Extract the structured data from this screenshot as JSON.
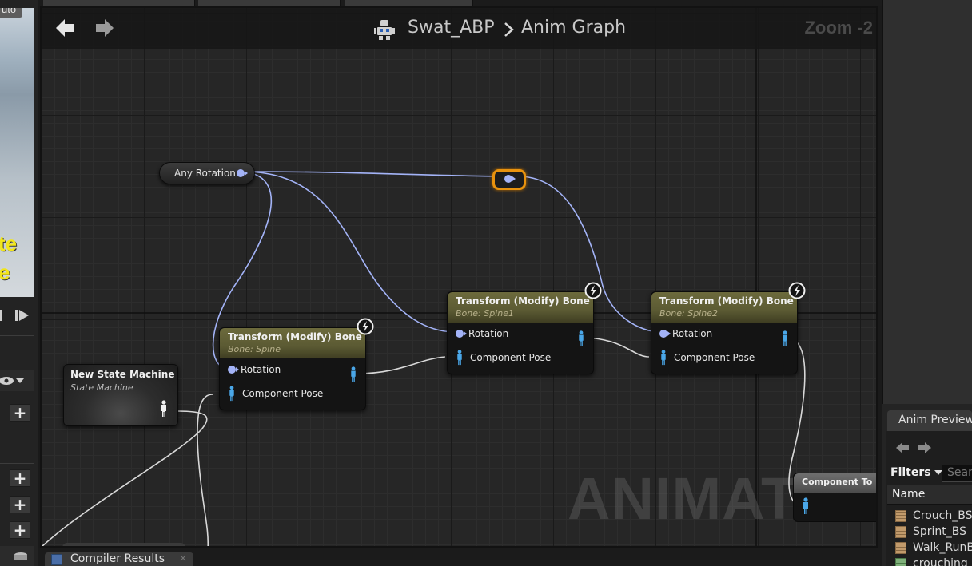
{
  "left": {
    "thumb_badge": "uto",
    "thumb_text_1": "te",
    "thumb_text_2": "e"
  },
  "graph": {
    "breadcrumb_asset": "Swat_ABP",
    "breadcrumb_graph": "Anim Graph",
    "zoom": "Zoom -2",
    "watermark": "ANIMATION"
  },
  "nodes": {
    "any_rotation": {
      "label": "Any Rotation"
    },
    "state_machine": {
      "title": "New State Machine",
      "subtitle": "State Machine"
    },
    "transform_spine": {
      "title": "Transform (Modify) Bone",
      "subtitle": "Bone: Spine",
      "pin_rotation": "Rotation",
      "pin_pose": "Component Pose"
    },
    "transform_spine1": {
      "title": "Transform (Modify) Bone",
      "subtitle": "Bone: Spine1",
      "pin_rotation": "Rotation",
      "pin_pose": "Component Pose"
    },
    "transform_spine2": {
      "title": "Transform (Modify) Bone",
      "subtitle": "Bone: Spine2",
      "pin_rotation": "Rotation",
      "pin_pose": "Component Pose"
    },
    "component_to_local": {
      "title": "Component To L"
    }
  },
  "right": {
    "tab_label": "Anim Preview",
    "filters_label": "Filters",
    "search_placeholder": "Searc",
    "name_header": "Name",
    "assets": [
      "Crouch_BS",
      "Sprint_BS",
      "Walk_RunB",
      "crouching"
    ]
  },
  "bottom": {
    "compiler_tab": "Compiler Results"
  },
  "colors": {
    "wire_rotation": "#a3b3f7",
    "wire_pose": "#d8d8d8",
    "reroute_highlight": "#e8920e",
    "node_header": "#6c6a3c"
  }
}
